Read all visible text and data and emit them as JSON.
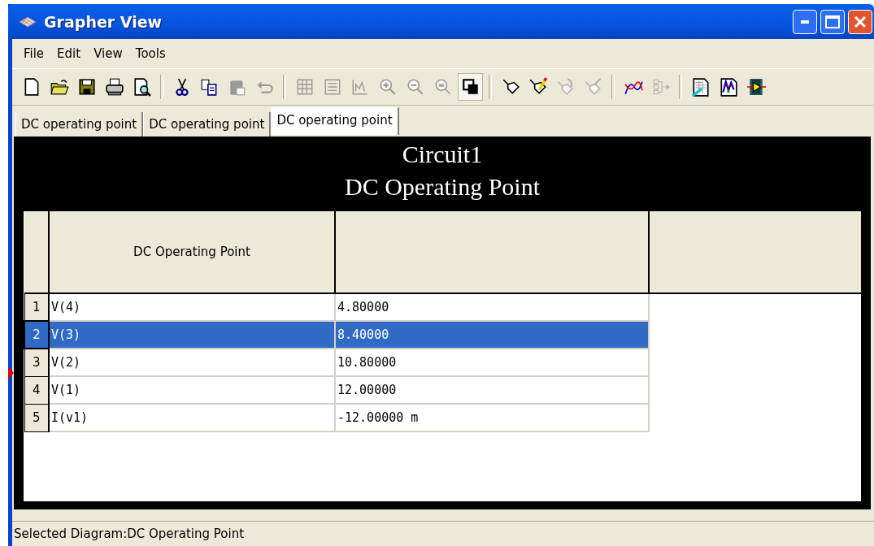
{
  "window": {
    "title": "Grapher View"
  },
  "menu": [
    "File",
    "Edit",
    "View",
    "Tools"
  ],
  "toolbar": [
    {
      "kind": "button",
      "disabled": false,
      "pressed": false
    },
    {
      "kind": "button",
      "disabled": false,
      "pressed": false
    },
    {
      "kind": "button",
      "disabled": false,
      "pressed": false
    },
    {
      "kind": "button",
      "disabled": false,
      "pressed": false
    },
    {
      "kind": "button",
      "disabled": false,
      "pressed": false
    },
    {
      "kind": "separator"
    },
    {
      "kind": "button",
      "disabled": false,
      "pressed": false
    },
    {
      "kind": "button",
      "disabled": false,
      "pressed": false
    },
    {
      "kind": "button",
      "disabled": true,
      "pressed": false
    },
    {
      "kind": "button",
      "disabled": true,
      "pressed": false
    },
    {
      "kind": "separator"
    },
    {
      "kind": "button",
      "disabled": true,
      "pressed": false
    },
    {
      "kind": "button",
      "disabled": true,
      "pressed": false
    },
    {
      "kind": "button",
      "disabled": true,
      "pressed": false
    },
    {
      "kind": "button",
      "disabled": true,
      "pressed": false
    },
    {
      "kind": "button",
      "disabled": true,
      "pressed": false
    },
    {
      "kind": "button",
      "disabled": true,
      "pressed": false
    },
    {
      "kind": "button",
      "disabled": false,
      "pressed": true
    },
    {
      "kind": "separator"
    },
    {
      "kind": "button",
      "disabled": false,
      "pressed": false
    },
    {
      "kind": "button",
      "disabled": false,
      "pressed": false
    },
    {
      "kind": "button",
      "disabled": true,
      "pressed": false
    },
    {
      "kind": "button",
      "disabled": true,
      "pressed": false
    },
    {
      "kind": "separator"
    },
    {
      "kind": "button",
      "disabled": false,
      "pressed": false
    },
    {
      "kind": "button",
      "disabled": true,
      "pressed": false
    },
    {
      "kind": "separator"
    },
    {
      "kind": "button",
      "disabled": false,
      "pressed": false
    },
    {
      "kind": "button",
      "disabled": false,
      "pressed": false
    },
    {
      "kind": "button",
      "disabled": false,
      "pressed": false
    }
  ],
  "tabs": [
    {
      "label": "DC operating point",
      "selected": false
    },
    {
      "label": "DC operating point",
      "selected": false
    },
    {
      "label": "DC operating point",
      "selected": true
    }
  ],
  "chart": {
    "title": "Circuit1",
    "subtitle": "DC Operating Point"
  },
  "table": {
    "columns": [
      "DC Operating Point"
    ],
    "rows": [
      {
        "number": "1",
        "name": "V(4)",
        "value": "4.80000",
        "selected": false
      },
      {
        "number": "2",
        "name": "V(3)",
        "value": "8.40000",
        "selected": true
      },
      {
        "number": "3",
        "name": "V(2)",
        "value": "10.80000",
        "selected": false
      },
      {
        "number": "4",
        "name": "V(1)",
        "value": "12.00000",
        "selected": false
      },
      {
        "number": "5",
        "name": "I(v1)",
        "value": "-12.00000 m",
        "selected": false
      }
    ]
  },
  "status_bar": "Selected Diagram:DC Operating Point"
}
